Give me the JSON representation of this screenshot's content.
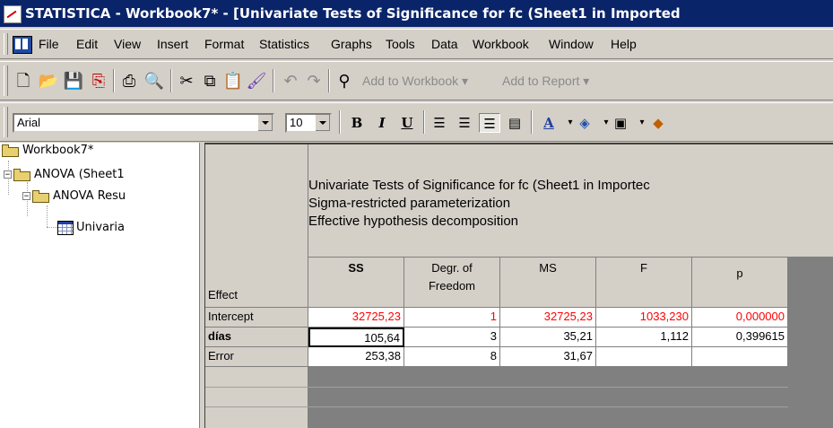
{
  "window": {
    "title": "STATISTICA - Workbook7* - [Univariate Tests of Significance for fc (Sheet1 in Imported"
  },
  "menu": [
    "File",
    "Edit",
    "View",
    "Insert",
    "Format",
    "Statistics",
    "Graphs",
    "Tools",
    "Data",
    "Workbook",
    "Window",
    "Help"
  ],
  "toolbar": {
    "add_to_workbook": "Add to Workbook ▾",
    "add_to_report": "Add to Report ▾"
  },
  "format_toolbar": {
    "font": "Arial",
    "size": "10",
    "bold": "B",
    "italic": "I",
    "underline": "U"
  },
  "tree": {
    "root": "Workbook7*",
    "anova": "ANOVA (Sheet1",
    "results": "ANOVA Resu",
    "univariate": "Univaria"
  },
  "spreadsheet": {
    "header_lines": [
      "Univariate Tests of Significance for fc (Sheet1 in Importec",
      "Sigma-restricted parameterization",
      "Effective hypothesis decomposition"
    ],
    "columns": [
      "Effect",
      "SS",
      "Degr. of\nFreedom",
      "MS",
      "F",
      "p"
    ],
    "col_line1": [
      "",
      "SS",
      "Degr. of",
      "MS",
      "F",
      "p"
    ],
    "col_line2": [
      "Effect",
      "",
      "Freedom",
      "",
      "",
      ""
    ],
    "rows": [
      {
        "effect": "Intercept",
        "ss": "32725,23",
        "df": "1",
        "ms": "32725,23",
        "f": "1033,230",
        "p": "0,000000",
        "highlight": true
      },
      {
        "effect": "días",
        "ss": "105,64",
        "df": "3",
        "ms": "35,21",
        "f": "1,112",
        "p": "0,399615",
        "highlight": false
      },
      {
        "effect": "Error",
        "ss": "253,38",
        "df": "8",
        "ms": "31,67",
        "f": "",
        "p": "",
        "highlight": false
      }
    ]
  },
  "colors": {
    "highlight_text": "#ff0000",
    "titlebar": "#0a246a"
  }
}
